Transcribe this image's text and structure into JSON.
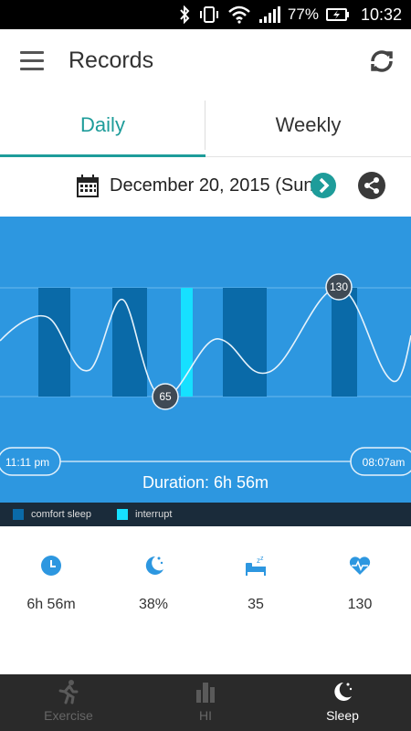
{
  "status_bar": {
    "battery_percent": "77%",
    "time": "10:32",
    "icons": [
      "bluetooth-icon",
      "vibrate-icon",
      "wifi-icon",
      "signal-icon",
      "battery-charging-icon"
    ]
  },
  "app_bar": {
    "title": "Records",
    "menu_icon": "menu-icon",
    "refresh_icon": "refresh-icon"
  },
  "tabs": [
    {
      "label": "Daily",
      "active": true
    },
    {
      "label": "Weekly",
      "active": false
    }
  ],
  "date_bar": {
    "date": "December 20, 2015 (Sun)",
    "calendar_icon": "calendar-icon",
    "next_icon": "chevron-right-icon",
    "share_icon": "share-icon"
  },
  "sleep_chart": {
    "start_time": "11:11 pm",
    "end_time": "08:07am",
    "duration_label": "Duration: 6h 56m",
    "max_marker": "130",
    "min_marker": "65",
    "colors": {
      "background": "#2d97e0",
      "comfort_sleep": "#0a6aa8",
      "interrupt": "#16e0ff",
      "legend_bg": "#1a2b3a"
    }
  },
  "legend": {
    "comfort_sleep": "comfort sleep",
    "interrupt": "interrupt"
  },
  "stats": [
    {
      "icon": "clock-icon",
      "value": "6h 56m"
    },
    {
      "icon": "moon-stars-icon",
      "value": "38%"
    },
    {
      "icon": "bed-zzz-icon",
      "value": "35"
    },
    {
      "icon": "heart-rate-icon",
      "value": "130"
    }
  ],
  "bottom_nav": [
    {
      "label": "Exercise",
      "icon": "runner-icon",
      "active": false
    },
    {
      "label": "HI",
      "icon": "bar-chart-icon",
      "active": false
    },
    {
      "label": "Sleep",
      "icon": "moon-stars-icon",
      "active": true
    }
  ],
  "accent_color": "#1e9c9a"
}
